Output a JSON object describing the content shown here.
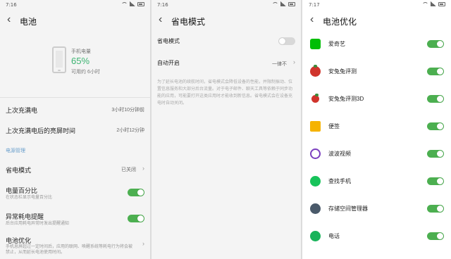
{
  "screen1": {
    "time": "7:16",
    "title": "电池",
    "battery_label": "手机电量",
    "battery_percent": "65%",
    "battery_remaining": "可用约 6小时",
    "rows": {
      "last_charged_label": "上次充满电",
      "last_charged_value": "3小时10分钟前",
      "screen_on_label": "上次充满电后的亮屏时间",
      "screen_on_value": "2小时12分钟"
    },
    "section_label": "电源管理",
    "power_saving": {
      "label": "省电模式",
      "value": "已关闭"
    },
    "battery_percent_row": {
      "label": "电量百分比",
      "sub": "在状态栏显示电量百分比",
      "enabled": true
    },
    "abnormal_alert": {
      "label": "异常耗电提醒",
      "sub": "后台应用耗电异常时发出提醒通知",
      "enabled": true
    },
    "optimize": {
      "label": "电池优化",
      "sub": "手机息屏超过一定时间后，应用的联网、唤醒系统等耗电行为将会被禁止，从而延长电池使用时间。"
    }
  },
  "screen2": {
    "time": "7:16",
    "title": "省电模式",
    "mode_label": "省电模式",
    "mode_enabled": false,
    "auto_label": "自动开启",
    "auto_value": "一律不",
    "description": "为了延长电池的续航时间，省电模式会降低设备的性能，并限制振动、位置信息服务和大部分后台流量。对于电子邮件、聊天工具等依赖于同步功能的应用，可能要打开这类应用时才能收到新信息。省电模式会在设备充电时自动关闭。"
  },
  "screen3": {
    "time": "7:17",
    "title": "电池优化",
    "apps": [
      {
        "name": "爱奇艺",
        "icon": "iqiyi-icon",
        "color": "#00be06",
        "enabled": true
      },
      {
        "name": "安兔兔评测",
        "icon": "antutu-icon",
        "color": "#d0342c",
        "enabled": true
      },
      {
        "name": "安兔兔评测3D",
        "icon": "antutu3d-icon",
        "color": "#d0342c",
        "enabled": true
      },
      {
        "name": "便签",
        "icon": "notes-icon",
        "color": "#f5b300",
        "enabled": true
      },
      {
        "name": "波波视频",
        "icon": "bobo-video-icon",
        "color": "#7b3fbf",
        "enabled": true
      },
      {
        "name": "查找手机",
        "icon": "find-phone-icon",
        "color": "#17c35a",
        "enabled": true
      },
      {
        "name": "存储空间管理器",
        "icon": "storage-manager-icon",
        "color": "#4a5a6a",
        "enabled": true
      },
      {
        "name": "电话",
        "icon": "phone-icon",
        "color": "#18b35a",
        "enabled": true
      }
    ]
  }
}
